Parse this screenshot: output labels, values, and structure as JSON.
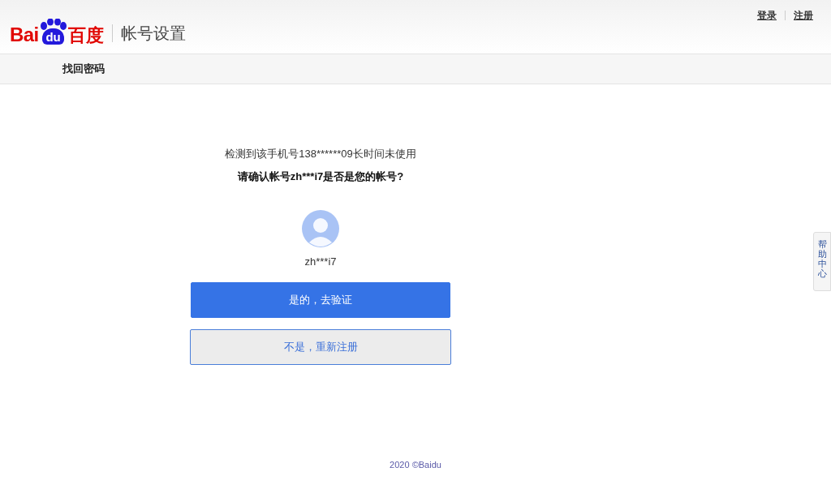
{
  "header": {
    "logo": {
      "left": "Bai",
      "mark": "du",
      "right": "百度"
    },
    "title": "帐号设置",
    "links": [
      "登录",
      "注册"
    ]
  },
  "nav": {
    "title": "找回密码"
  },
  "notice": "检测到该手机号138******09长时间未使用",
  "question": "请确认帐号zh***i7是否是您的帐号?",
  "account": {
    "name": "zh***i7"
  },
  "buttons": [
    {
      "label": "是的，去验证",
      "kind": "primary"
    },
    {
      "label": "不是，重新注册",
      "kind": "secondary"
    }
  ],
  "help": "帮助中心",
  "footer": "2020 ©Baidu"
}
